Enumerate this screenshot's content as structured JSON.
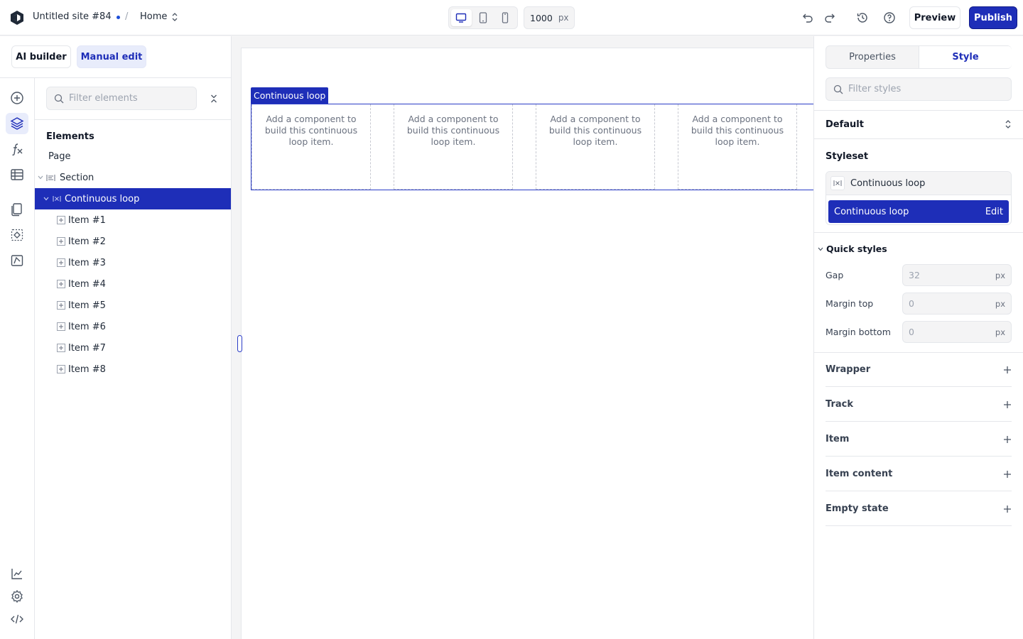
{
  "header": {
    "site_title": "Untitled site #84",
    "separator": "/",
    "page_name": "Home",
    "width_value": "1000",
    "width_unit": "px",
    "preview_label": "Preview",
    "publish_label": "Publish"
  },
  "modes": {
    "ai_builder": "AI builder",
    "manual_edit": "Manual edit"
  },
  "elements_panel": {
    "filter_placeholder": "Filter elements",
    "heading": "Elements",
    "tree": [
      {
        "label": "Page"
      },
      {
        "label": "Section"
      },
      {
        "label": "Continuous loop"
      },
      {
        "label": "Item #1"
      },
      {
        "label": "Item #2"
      },
      {
        "label": "Item #3"
      },
      {
        "label": "Item #4"
      },
      {
        "label": "Item #5"
      },
      {
        "label": "Item #6"
      },
      {
        "label": "Item #7"
      },
      {
        "label": "Item #8"
      }
    ]
  },
  "canvas": {
    "component_tag": "Continuous loop",
    "items": [
      {
        "text": "Add a component to build this continuous loop item."
      },
      {
        "text": "Add a component to build this continuous loop item."
      },
      {
        "text": "Add a component to build this continuous loop item."
      },
      {
        "text": "Add a component to build this continuous loop item."
      }
    ]
  },
  "style_panel": {
    "tabs": {
      "properties": "Properties",
      "style": "Style"
    },
    "filter_placeholder": "Filter styles",
    "state": "Default",
    "styleset_heading": "Styleset",
    "styleset_parent": "Continuous loop",
    "styleset_active": "Continuous loop",
    "edit_label": "Edit",
    "quick_styles": {
      "heading": "Quick styles",
      "gap": {
        "label": "Gap",
        "placeholder": "32",
        "unit": "px"
      },
      "margin_top": {
        "label": "Margin top",
        "placeholder": "0",
        "unit": "px"
      },
      "margin_bottom": {
        "label": "Margin bottom",
        "placeholder": "0",
        "unit": "px"
      }
    },
    "sections": [
      "Wrapper",
      "Track",
      "Item",
      "Item content",
      "Empty state"
    ]
  },
  "colors": {
    "accent": "#1e2eb8",
    "accent_light": "#e8ecfb",
    "border": "#e5e7eb"
  }
}
